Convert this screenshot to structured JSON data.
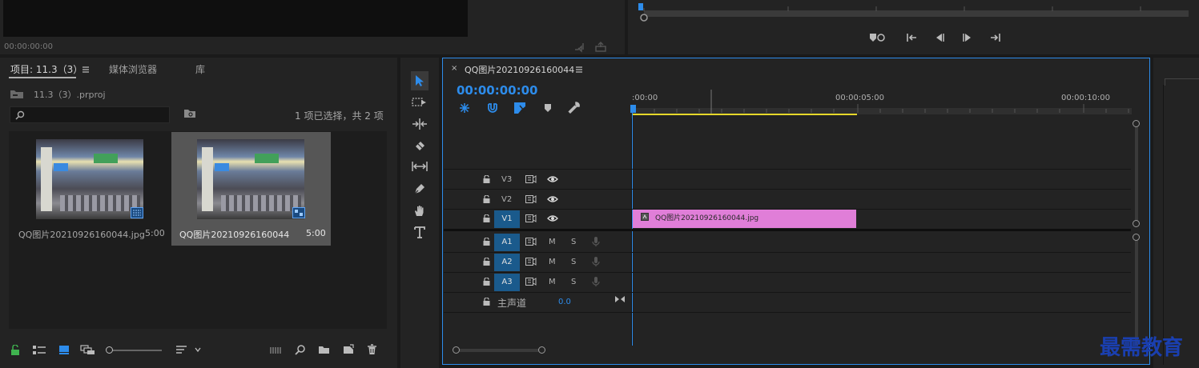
{
  "source_monitor": {
    "timecode": "00:00:00:00"
  },
  "project": {
    "tabs": [
      {
        "label": "项目: 11.3（3）"
      },
      {
        "label": "媒体浏览器"
      },
      {
        "label": "库"
      }
    ],
    "path": "11.3（3）.prproj",
    "selection_status": "1 项已选择，共 2 项",
    "search_value": "",
    "items": [
      {
        "name": "QQ图片20210926160044.jpg",
        "duration": "5:00"
      },
      {
        "name": "QQ图片20210926160044",
        "duration": "5:00"
      }
    ]
  },
  "timeline": {
    "sequence_name": "QQ图片20210926160044",
    "timecode": "00:00:00:00",
    "ruler": [
      ":00:00",
      "00:00:05:00",
      "00:00:10:00"
    ],
    "video_tracks": [
      "V3",
      "V2",
      "V1"
    ],
    "audio_tracks": [
      "A1",
      "A2",
      "A3"
    ],
    "mute_label": "M",
    "solo_label": "S",
    "master": {
      "label": "主声道",
      "value": "0.0"
    },
    "clip": {
      "name": "QQ图片20210926160044.jpg",
      "color": "#e07ed8"
    }
  },
  "watermark": "最需教育",
  "colors": {
    "accent": "#2d8ceb",
    "clip": "#e07ed8",
    "work_area": "#e6d82a",
    "watermark": "#1a3fb0"
  }
}
